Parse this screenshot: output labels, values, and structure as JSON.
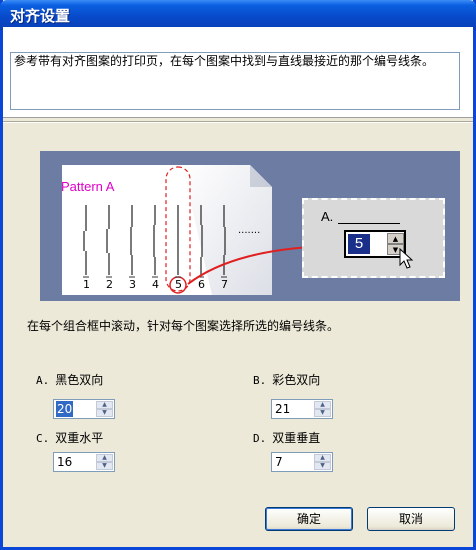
{
  "window": {
    "title": "对齐设置"
  },
  "description": "参考带有对齐图案的打印页，在每个图案中找到与直线最接近的那个编号线条。",
  "illustration": {
    "pattern_title": "Pattern A",
    "ticks": [
      "1",
      "2",
      "3",
      "4",
      "5",
      "6",
      "7"
    ],
    "highlight_tick": "5",
    "ellipsis": ".......",
    "panel_label": "A.",
    "panel_value": "5"
  },
  "instruction": "在每个组合框中滚动，针对每个图案选择所选的编号线条。",
  "fields": [
    {
      "key": "A.",
      "label": "黑色双向",
      "value": "20",
      "selected": true
    },
    {
      "key": "B.",
      "label": "彩色双向",
      "value": "21",
      "selected": false
    },
    {
      "key": "C.",
      "label": "双重水平",
      "value": "16",
      "selected": false
    },
    {
      "key": "D.",
      "label": "双重垂直",
      "value": "7",
      "selected": false
    }
  ],
  "buttons": {
    "ok": "确定",
    "cancel": "取消"
  },
  "colors": {
    "title_bar": "#0a5fe0",
    "illustration_bg": "#6d7ca2",
    "pattern_title": "#e000c8",
    "highlight": "#e02020"
  }
}
